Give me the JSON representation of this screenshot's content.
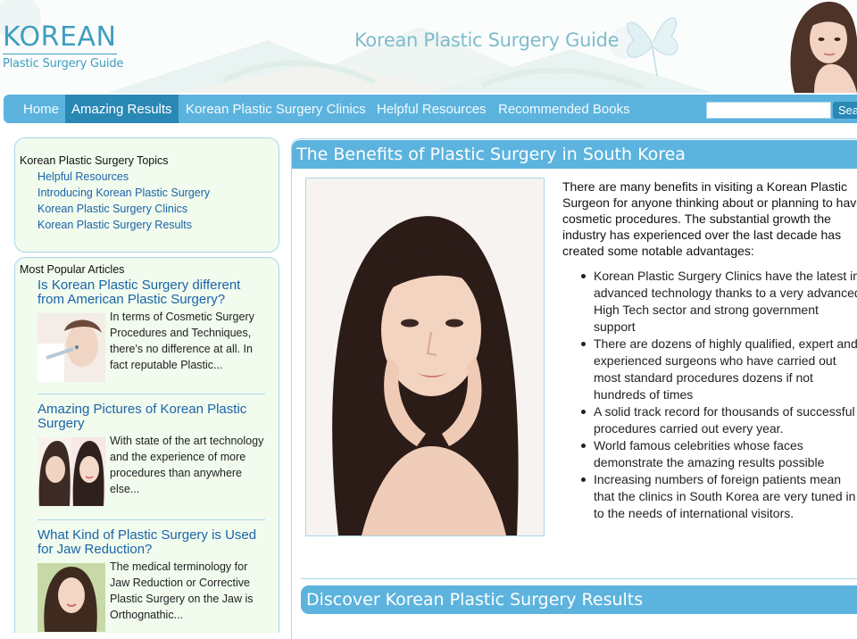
{
  "header": {
    "logo_main": "KOREAN",
    "logo_sub": "Plastic Surgery Guide",
    "site_title": "Korean Plastic Surgery Guide"
  },
  "nav": {
    "items": [
      {
        "label": "Home"
      },
      {
        "label": "Amazing Results",
        "active": true
      },
      {
        "label": "Korean Plastic Surgery Clinics"
      },
      {
        "label": "Helpful Resources"
      },
      {
        "label": "Recommended Books"
      }
    ],
    "search_value": "",
    "search_button": "Sea"
  },
  "sidebar": {
    "topics_heading": "Korean Plastic Surgery Topics",
    "topics": [
      "Helpful Resources",
      "Introducing Korean Plastic Surgery",
      "Korean Plastic Surgery Clinics",
      "Korean Plastic Surgery Results"
    ],
    "popular_heading": "Most Popular Articles",
    "articles": [
      {
        "title": "Is Korean Plastic Surgery different from American Plastic Surgery?",
        "excerpt": "In terms of Cosmetic Surgery Procedures and Techniques, there's no difference at all. In fact reputable Plastic..."
      },
      {
        "title": "Amazing Pictures of Korean Plastic Surgery",
        "excerpt": "With state of the art technology and the experience of more procedures than anywhere else..."
      },
      {
        "title": "What Kind of Plastic Surgery is Used for Jaw Reduction?",
        "excerpt": "The medical terminology for Jaw Reduction or Corrective Plastic Surgery on the Jaw is Orthognathic..."
      }
    ]
  },
  "main": {
    "heading": "The Benefits of Plastic Surgery in South Korea",
    "intro": "There are many benefits in visiting a Korean Plastic Surgeon for anyone thinking about or planning to have cosmetic procedures. The substantial growth the industry has experienced over the last decade has created some notable advantages:",
    "benefits": [
      "Korean Plastic Surgery Clinics have the latest in advanced technology thanks to a very advanced High Tech sector and strong government support",
      "There are dozens of  highly qualified, expert and experienced surgeons who have carried out most standard procedures dozens if not hundreds of times",
      "A solid track record for thousands of successful procedures carried out every year.",
      "World famous celebrities whose faces demonstrate the amazing results possible",
      "Increasing numbers of foreign patients mean that the clinics in South Korea are very tuned in to the needs of international visitors."
    ],
    "section_heading": "Discover Korean Plastic Surgery Results"
  }
}
